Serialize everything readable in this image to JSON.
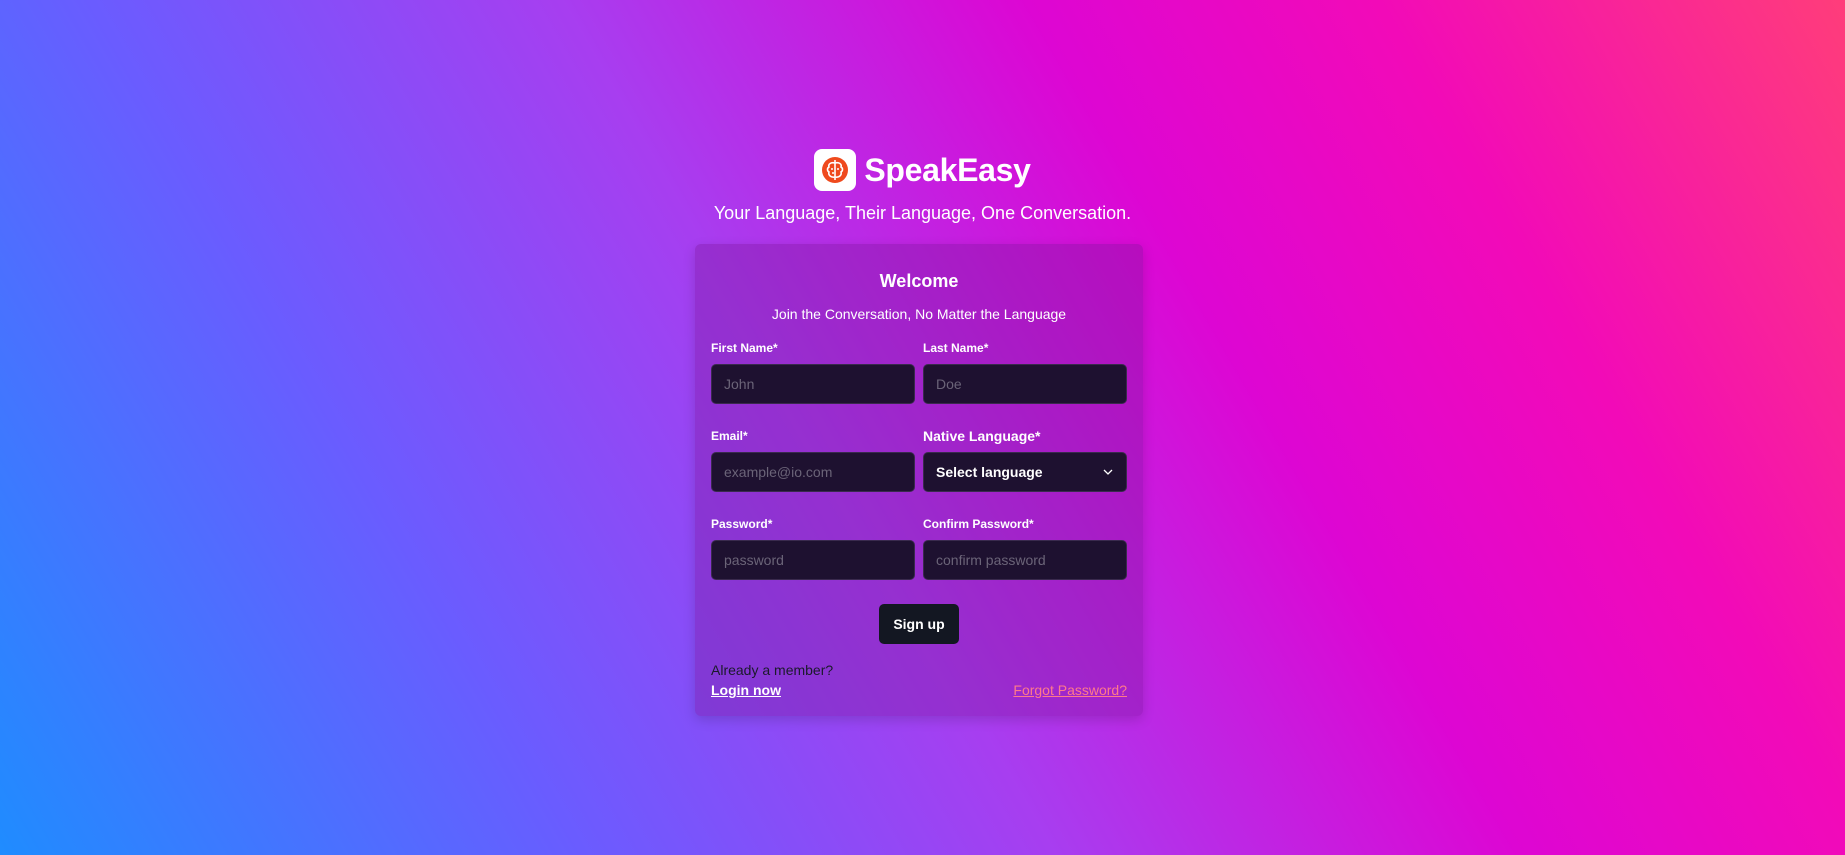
{
  "brand": {
    "name": "SpeakEasy",
    "logo_icon": "brain-icon",
    "logo_color": "#ef4a1e"
  },
  "tagline": "Your Language, Their Language, One Conversation.",
  "form": {
    "title": "Welcome",
    "subtitle": "Join the Conversation, No Matter the Language",
    "first_name": {
      "label": "First Name*",
      "placeholder": "John",
      "value": ""
    },
    "last_name": {
      "label": "Last Name*",
      "placeholder": "Doe",
      "value": ""
    },
    "email": {
      "label": "Email*",
      "placeholder": "example@io.com",
      "value": ""
    },
    "native_language": {
      "label": "Native Language*",
      "selected": "Select language"
    },
    "password": {
      "label": "Password*",
      "placeholder": "password",
      "value": ""
    },
    "confirm_password": {
      "label": "Confirm Password*",
      "placeholder": "confirm password",
      "value": ""
    },
    "submit_label": "Sign up"
  },
  "footer": {
    "member_text": "Already a member?",
    "login_link": "Login now",
    "forgot_link": "Forgot Password?"
  },
  "colors": {
    "accent_link": "#ff7a8a",
    "button_bg": "#131722",
    "input_bg": "#1e1130"
  }
}
